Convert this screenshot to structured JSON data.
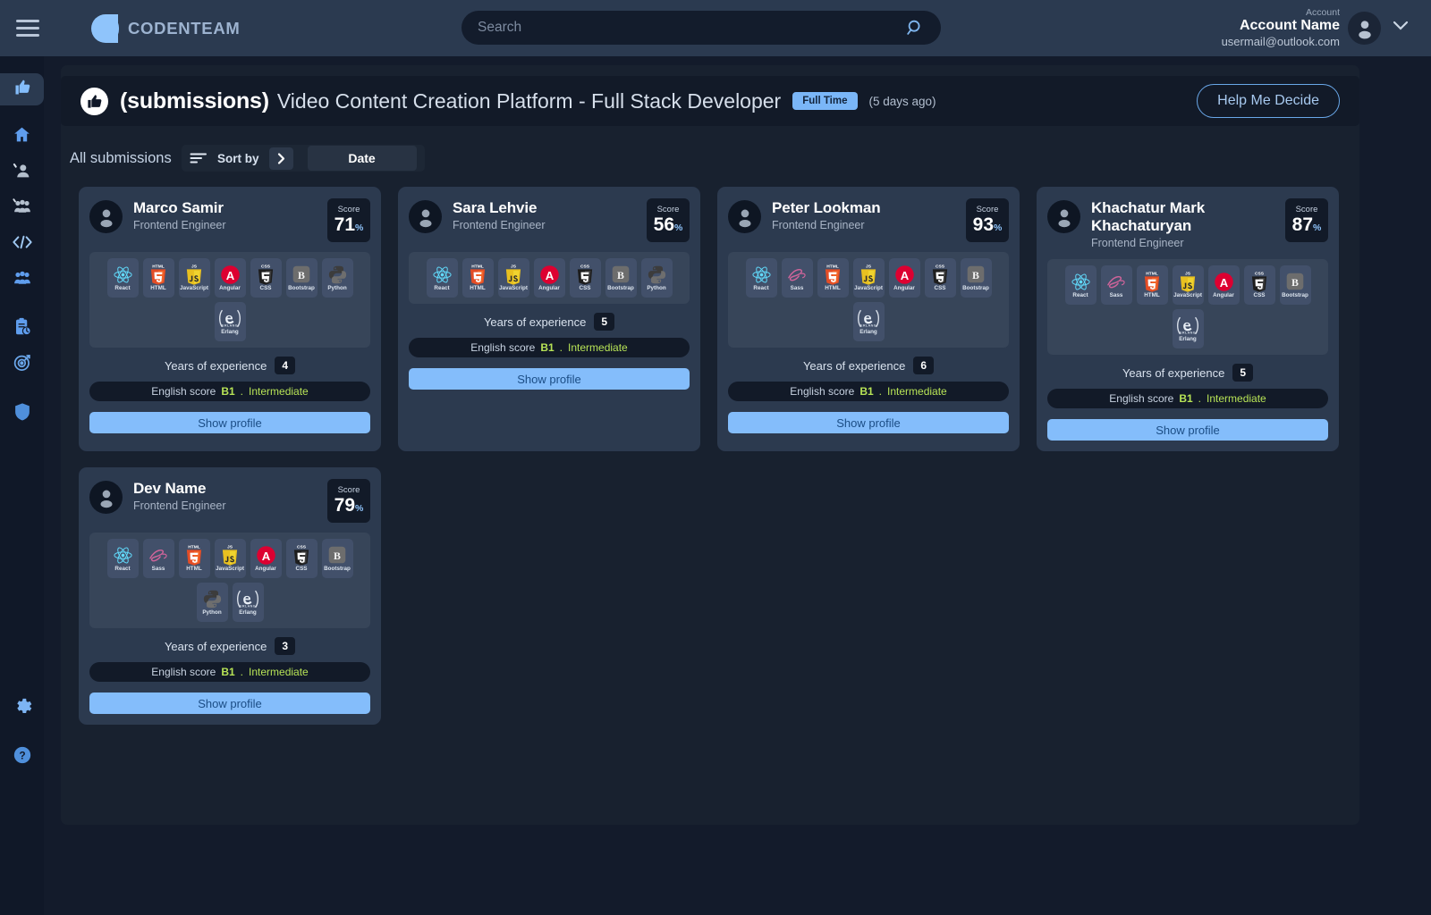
{
  "header": {
    "brand": "CODENTEAM",
    "menu_icon": "hamburger-icon",
    "search": {
      "value": "",
      "placeholder": "Search",
      "icon": "search-icon"
    },
    "account": {
      "label": "Account",
      "name": "Account Name",
      "email": "usermail@outlook.com",
      "avatar_icon": "user-avatar-icon",
      "chevron_icon": "chevron-down-icon"
    }
  },
  "sidebar": {
    "items": [
      {
        "name": "submissions",
        "icon": "thumbs-up-icon",
        "active": true
      },
      {
        "name": "home",
        "icon": "home-icon",
        "active": false
      },
      {
        "name": "profile",
        "icon": "user-edit-icon",
        "active": false
      },
      {
        "name": "teams",
        "icon": "people-group-icon",
        "active": false
      },
      {
        "name": "code",
        "icon": "code-brackets-icon",
        "active": false
      },
      {
        "name": "candidates",
        "icon": "people-filled-icon",
        "active": false
      },
      {
        "name": "assessments",
        "icon": "clipboard-clock-icon",
        "active": false
      },
      {
        "name": "targets",
        "icon": "target-icon",
        "active": false
      },
      {
        "name": "security",
        "icon": "shield-icon",
        "active": false
      }
    ],
    "bottom_items": [
      {
        "name": "settings",
        "icon": "gear-icon"
      },
      {
        "name": "help",
        "icon": "question-circle-icon"
      }
    ]
  },
  "page": {
    "icon": "thumbs-up-circle-icon",
    "section": "(submissions)",
    "title": "Video Content Creation Platform - Full Stack Developer",
    "employment_badge": "Full Time",
    "posted": "(5 days  ago)",
    "help_button": "Help Me Decide"
  },
  "toolbar": {
    "all_submissions": "All submissions",
    "sort_icon": "sort-lines-icon",
    "sort_by": "Sort by",
    "chevron_icon": "chevron-right-icon",
    "sort_field": "Date"
  },
  "labels": {
    "score": "Score",
    "percent": "%",
    "years_of_experience": "Years of experience",
    "english_score": "English score",
    "show_profile": "Show profile",
    "level_separator": "."
  },
  "colors": {
    "accent_blue": "#84bdfb",
    "badge_blue": "#7ab6f7",
    "english_green": "#b7e356",
    "card_bg": "#2c3a4f",
    "panel_bg": "#18212f",
    "page_bg": "#131b2b",
    "topbar_bg": "#2b3a50",
    "sidebar_bg": "#101828"
  },
  "candidates": [
    {
      "name": "Marco Samir",
      "role": "Frontend Engineer",
      "score": "71",
      "years_of_experience": "4",
      "english_level": "B1",
      "english_desc": "Intermediate",
      "skills": [
        "React",
        "HTML",
        "JavaScript",
        "Angular",
        "CSS",
        "Bootstrap",
        "Python",
        "Erlang"
      ]
    },
    {
      "name": "Sara Lehvie",
      "role": "Frontend Engineer",
      "score": "56",
      "years_of_experience": "5",
      "english_level": "B1",
      "english_desc": "Intermediate",
      "skills": [
        "React",
        "HTML",
        "JavaScript",
        "Angular",
        "CSS",
        "Bootstrap",
        "Python"
      ]
    },
    {
      "name": "Peter Lookman",
      "role": "Frontend Engineer",
      "score": "93",
      "years_of_experience": "6",
      "english_level": "B1",
      "english_desc": "Intermediate",
      "skills": [
        "React",
        "Sass",
        "HTML",
        "JavaScript",
        "Angular",
        "CSS",
        "Bootstrap",
        "Erlang"
      ]
    },
    {
      "name": "Khachatur Mark Khachaturyan",
      "role": "Frontend Engineer",
      "score": "87",
      "years_of_experience": "5",
      "english_level": "B1",
      "english_desc": "Intermediate",
      "skills": [
        "React",
        "Sass",
        "HTML",
        "JavaScript",
        "Angular",
        "CSS",
        "Bootstrap",
        "Erlang"
      ]
    },
    {
      "name": "Dev Name",
      "role": "Frontend Engineer",
      "score": "79",
      "years_of_experience": "3",
      "english_level": "B1",
      "english_desc": "Intermediate",
      "skills": [
        "React",
        "Sass",
        "HTML",
        "JavaScript",
        "Angular",
        "CSS",
        "Bootstrap",
        "Python",
        "Erlang"
      ]
    }
  ]
}
